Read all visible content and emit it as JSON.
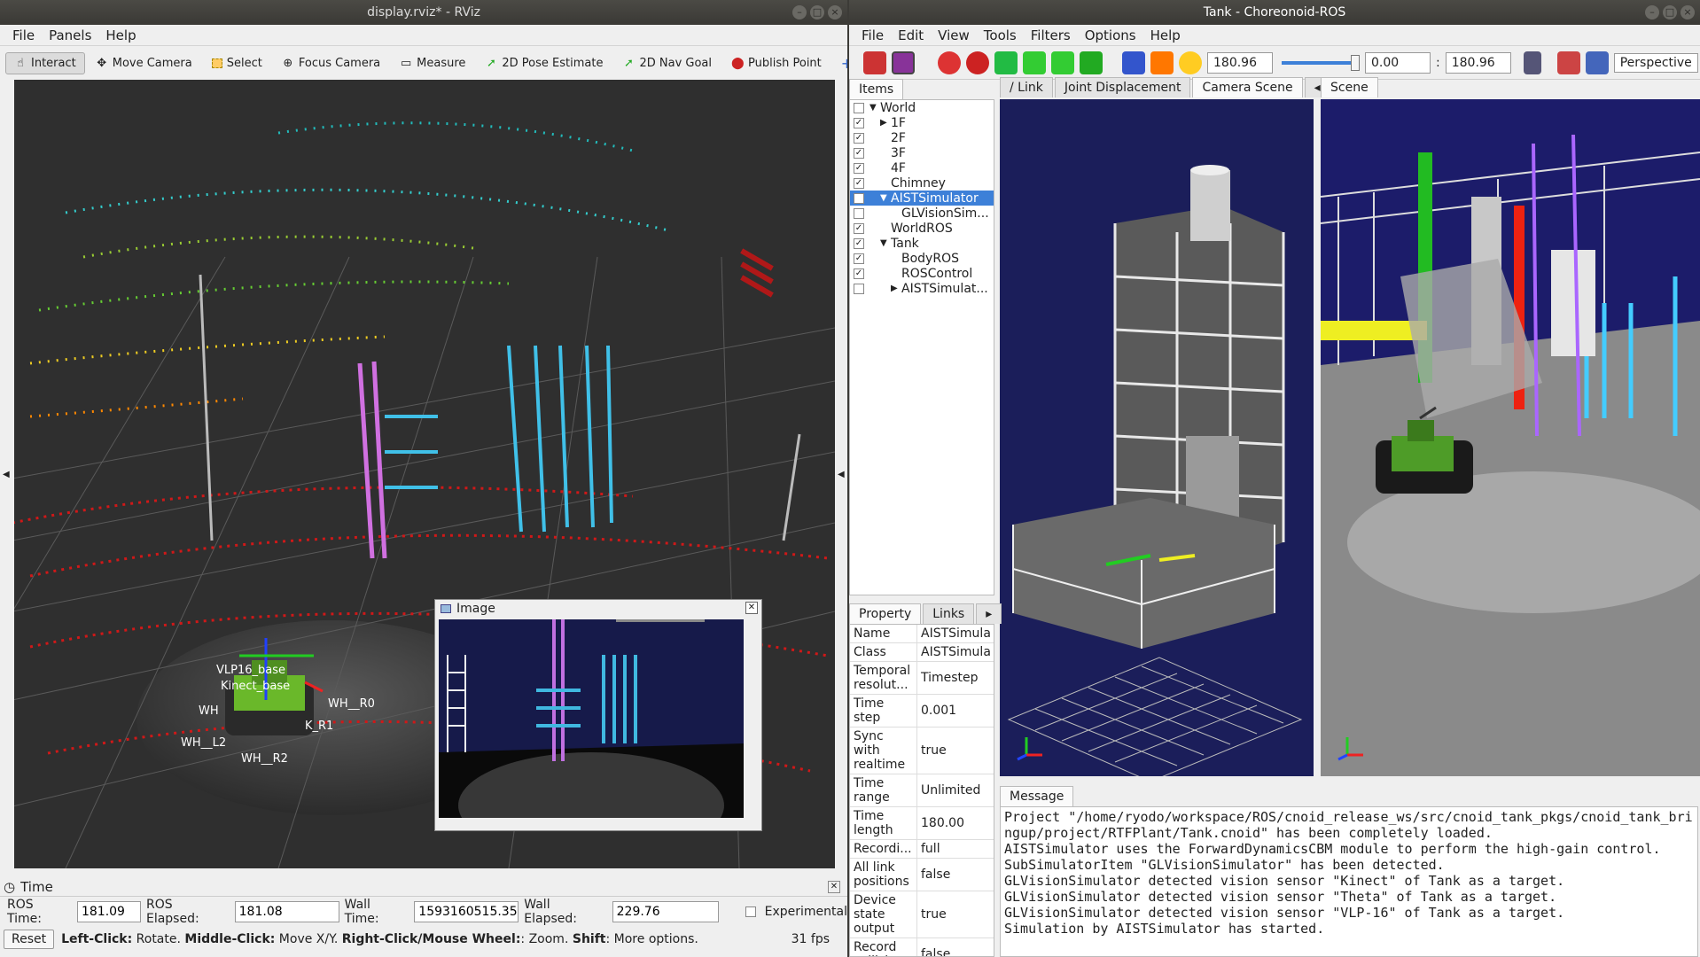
{
  "rviz": {
    "title": "display.rviz* - RViz",
    "menu": [
      "File",
      "Panels",
      "Help"
    ],
    "tools": [
      {
        "label": "Interact",
        "icon": "cursor-icon"
      },
      {
        "label": "Move Camera",
        "icon": "move-icon"
      },
      {
        "label": "Select",
        "icon": "select-icon"
      },
      {
        "label": "Focus Camera",
        "icon": "focus-icon"
      },
      {
        "label": "Measure",
        "icon": "ruler-icon"
      },
      {
        "label": "2D Pose Estimate",
        "icon": "arrow-green-icon"
      },
      {
        "label": "2D Nav Goal",
        "icon": "arrow-green-icon"
      },
      {
        "label": "Publish Point",
        "icon": "pin-icon"
      }
    ],
    "image_panel_title": "Image",
    "robot_labels": [
      "VLP16_base",
      "Kinect_base",
      "WH__R0",
      "WH__L2",
      "WH__R2",
      "K_R1",
      "WH"
    ],
    "time": {
      "title": "Time",
      "ros_time_label": "ROS Time:",
      "ros_time": "181.09",
      "ros_elapsed_label": "ROS Elapsed:",
      "ros_elapsed": "181.08",
      "wall_time_label": "Wall Time:",
      "wall_time": "1593160515.35",
      "wall_elapsed_label": "Wall Elapsed:",
      "wall_elapsed": "229.76",
      "experimental": "Experimental"
    },
    "status": {
      "reset": "Reset",
      "hint_a": "Left-Click:",
      "hint_a_t": " Rotate. ",
      "hint_b": "Middle-Click:",
      "hint_b_t": " Move X/Y. ",
      "hint_c": "Right-Click/Mouse Wheel:",
      "hint_c_t": ": Zoom. ",
      "hint_d": "Shift",
      "hint_d_t": ": More options.",
      "fps": "31 fps"
    }
  },
  "cnoid": {
    "title": "Tank - Choreonoid-ROS",
    "menu": [
      "File",
      "Edit",
      "View",
      "Tools",
      "Filters",
      "Options",
      "Help"
    ],
    "time_a": "180.96",
    "time_b": "0.00",
    "time_c": "180.96",
    "view_mode": "Perspective",
    "tabs_left": [
      "Items"
    ],
    "tabs_mid": [
      "/ Link",
      "Joint Displacement",
      "Camera Scene"
    ],
    "tabs_right": [
      "Scene"
    ],
    "items": [
      {
        "label": "World",
        "depth": 0,
        "checked": false,
        "arrow": "▼"
      },
      {
        "label": "1F",
        "depth": 1,
        "checked": true,
        "arrow": "▶"
      },
      {
        "label": "2F",
        "depth": 1,
        "checked": true,
        "arrow": ""
      },
      {
        "label": "3F",
        "depth": 1,
        "checked": true,
        "arrow": ""
      },
      {
        "label": "4F",
        "depth": 1,
        "checked": true,
        "arrow": ""
      },
      {
        "label": "Chimney",
        "depth": 1,
        "checked": true,
        "arrow": ""
      },
      {
        "label": "AISTSimulator",
        "depth": 1,
        "checked": true,
        "arrow": "▼",
        "selected": true
      },
      {
        "label": "GLVisionSim...",
        "depth": 2,
        "checked": false,
        "arrow": ""
      },
      {
        "label": "WorldROS",
        "depth": 1,
        "checked": true,
        "arrow": ""
      },
      {
        "label": "Tank",
        "depth": 1,
        "checked": true,
        "arrow": "▼"
      },
      {
        "label": "BodyROS",
        "depth": 2,
        "checked": true,
        "arrow": ""
      },
      {
        "label": "ROSControl",
        "depth": 2,
        "checked": true,
        "arrow": ""
      },
      {
        "label": "AISTSimulat...",
        "depth": 2,
        "checked": false,
        "arrow": "▶"
      }
    ],
    "prop_tabs": [
      "Property",
      "Links"
    ],
    "properties": [
      {
        "k": "Name",
        "v": "AISTSimula"
      },
      {
        "k": "Class",
        "v": "AISTSimula"
      },
      {
        "k": "Temporal resolut...",
        "v": "Timestep"
      },
      {
        "k": "Time step",
        "v": "0.001"
      },
      {
        "k": "Sync with realtime",
        "v": "true"
      },
      {
        "k": "Time range",
        "v": "Unlimited"
      },
      {
        "k": "Time length",
        "v": "180.00"
      },
      {
        "k": "Recordi...",
        "v": "full"
      },
      {
        "k": "All link positions",
        "v": "false"
      },
      {
        "k": "Device state output",
        "v": "true"
      },
      {
        "k": "Record collision",
        "v": "false"
      }
    ],
    "message_tab": "Message",
    "messages": [
      "Project \"/home/ryodo/workspace/ROS/cnoid_release_ws/src/cnoid_tank_pkgs/cnoid_tank_bringup/project/RTFPlant/Tank.cnoid\" has been completely loaded.",
      "AISTSimulator uses the ForwardDynamicsCBM module to perform the high-gain control.",
      "SubSimulatorItem \"GLVisionSimulator\" has been detected.",
      "GLVisionSimulator detected vision sensor \"Kinect\" of Tank as a target.",
      "GLVisionSimulator detected vision sensor \"Theta\" of Tank as a target.",
      "GLVisionSimulator detected vision sensor \"VLP-16\" of Tank as a target.",
      "Simulation by AISTSimulator has started."
    ]
  }
}
